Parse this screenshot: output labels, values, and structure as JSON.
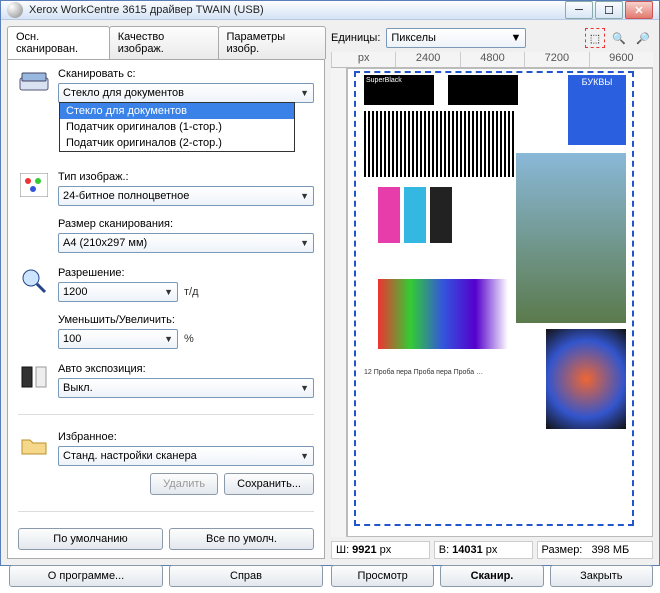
{
  "window": {
    "title": "Xerox WorkCentre 3615 драйвер TWAIN (USB)"
  },
  "tabs": [
    "Осн. сканирован.",
    "Качество изображ.",
    "Параметры изобр."
  ],
  "scan_from": {
    "label": "Сканировать с:",
    "value": "Стекло для документов",
    "options": [
      "Стекло для документов",
      "Податчик оригиналов (1-стор.)",
      "Податчик оригиналов (2-стор.)"
    ]
  },
  "image_type": {
    "label": "Тип изображ.:",
    "value": "24-битное полноцветное"
  },
  "scan_size": {
    "label": "Размер сканирования:",
    "value": "A4 (210x297 мм)"
  },
  "resolution": {
    "label": "Разрешение:",
    "value": "1200",
    "unit": "т/д"
  },
  "scale": {
    "label": "Уменьшить/Увеличить:",
    "value": "100",
    "unit": "%"
  },
  "auto_exposure": {
    "label": "Авто экспозиция:",
    "value": "Выкл."
  },
  "favorites": {
    "label": "Избранное:",
    "value": "Станд. настройки сканера"
  },
  "buttons": {
    "delete": "Удалить",
    "save": "Сохранить...",
    "defaults": "По умолчанию",
    "all_defaults": "Все по умолч.",
    "about": "О программе...",
    "help": "Справ",
    "preview": "Просмотр",
    "scan": "Сканир.",
    "close": "Закрыть"
  },
  "units": {
    "label": "Единицы:",
    "value": "Пикселы"
  },
  "ruler": {
    "px": "px",
    "ticks": [
      "2400",
      "4800",
      "7200",
      "9600"
    ]
  },
  "status": {
    "w_label": "Ш:",
    "w_val": "9921",
    "w_unit": "px",
    "h_label": "В:",
    "h_val": "14031",
    "h_unit": "px",
    "size_label": "Размер:",
    "size_val": "398 МБ"
  }
}
